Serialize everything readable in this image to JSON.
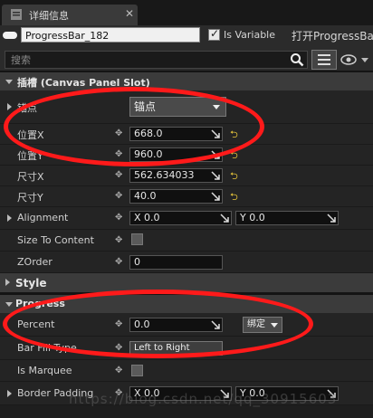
{
  "tab": {
    "title": "详细信息"
  },
  "toolbar": {
    "widget_name": "ProgressBar_182",
    "is_variable_label": "Is Variable",
    "open_label": "打开ProgressBa",
    "search_placeholder": "搜索"
  },
  "sections": {
    "slot": "插槽 (Canvas Panel Slot)",
    "style": "Style",
    "progress": "Progress"
  },
  "slot_rows": {
    "anchor_label": "锚点",
    "anchor_value": "锚点",
    "pos_x_label": "位置X",
    "pos_x_value": "668.0",
    "pos_y_label": "位置Y",
    "pos_y_value": "960.0",
    "size_x_label": "尺寸X",
    "size_x_value": "562.634033",
    "size_y_label": "尺寸Y",
    "size_y_value": "40.0",
    "alignment_label": "Alignment",
    "align_x": "X  0.0",
    "align_y": "Y  0.0",
    "size_to_content_label": "Size To Content",
    "zorder_label": "ZOrder",
    "zorder_value": "0"
  },
  "progress_rows": {
    "percent_label": "Percent",
    "percent_value": "0.0",
    "bind_label": "绑定",
    "bar_fill_type_label": "Bar Fill Type",
    "bar_fill_type_value": "Left to Right",
    "is_marquee_label": "Is Marquee",
    "border_padding_label": "Border Padding",
    "border_x": "X  0.0",
    "border_y": "Y  0.0"
  },
  "watermark": "https://blog.csdn.net/qq_30915603",
  "colors": {
    "annotation": "#ff1a1a",
    "reset_arrow": "#e3c23a"
  }
}
